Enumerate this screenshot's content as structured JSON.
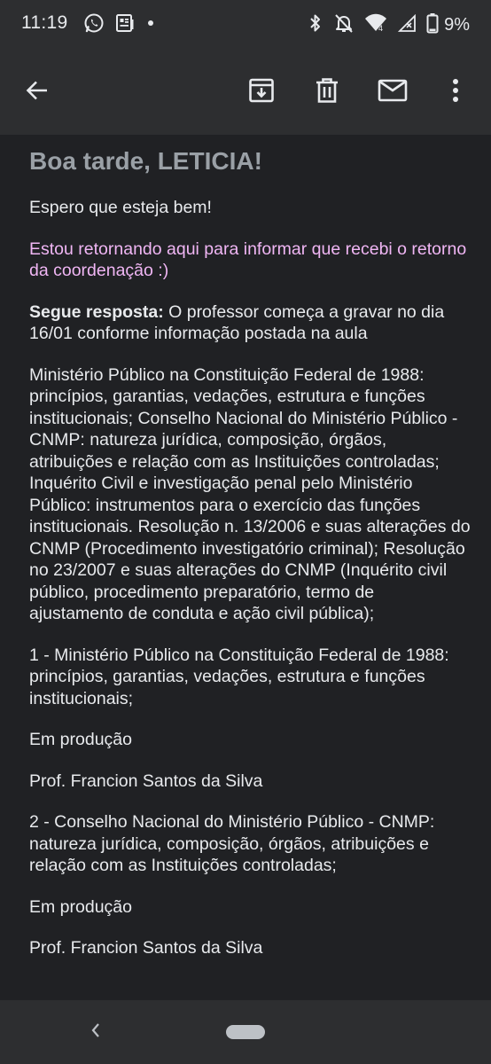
{
  "status_bar": {
    "time": "11:19",
    "battery": "9%",
    "left_icons": [
      "whatsapp-icon",
      "news-icon",
      "dot-icon"
    ],
    "right_icons": [
      "bluetooth-icon",
      "mute-icon",
      "wifi-icon",
      "signal-icon",
      "battery-icon"
    ]
  },
  "app_bar": {
    "actions": [
      "back-arrow-icon",
      "archive-icon",
      "delete-icon",
      "mark-unread-icon",
      "more-vert-icon"
    ]
  },
  "email": {
    "greeting": "Boa tarde, LETICIA!",
    "p1": "Espero que esteja bem!",
    "p2": "Estou retornando aqui para informar que recebi o retorno da coordenação :)",
    "p3_label": "Segue resposta:",
    "p3_text": "  O professor começa a gravar no dia 16/01 conforme informação postada na aula",
    "p4": "Ministério Público na Constituição Federal de 1988: princípios, garantias, vedações, estrutura e funções institucionais; Conselho Nacional do Ministério Público - CNMP: natureza jurídica, composição, órgãos, atribuições e relação com as Instituições controladas; Inquérito Civil e investigação penal pelo Ministério Público: instrumentos para o exercício das funções institucionais. Resolução n. 13/2006 e suas alterações do CNMP (Procedimento investigatório criminal); Resolução no 23/2007 e suas alterações do CNMP (Inquérito civil público, procedimento preparatório, termo de ajustamento de conduta e ação civil pública);",
    "p5": " 1 - Ministério Público na Constituição Federal de 1988: princípios, garantias, vedações, estrutura e funções institucionais;",
    "p6": "Em produção",
    "p7": "Prof. Francion Santos da Silva",
    "p8": " 2 - Conselho Nacional do Ministério Público - CNMP: natureza jurídica, composição, órgãos, atribuições e relação com as Instituições controladas;",
    "p9": "Em produção",
    "p10": "Prof. Francion Santos da Silva"
  },
  "colors": {
    "background": "#202124",
    "bars": "#2d2e30",
    "text": "#e8eaed",
    "greeting": "#9aa0a6",
    "quoted": "#f0b6f4"
  }
}
